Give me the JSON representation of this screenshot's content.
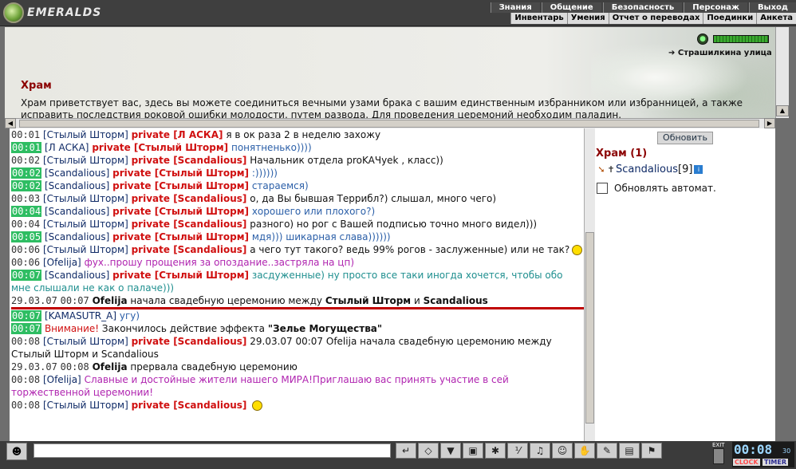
{
  "app": {
    "logo_text": "EMERALDS"
  },
  "menu": {
    "main": [
      "Знания",
      "Общение",
      "Безопасность",
      "Персонаж",
      "Выход"
    ],
    "sub": [
      "Инвентарь",
      "Умения",
      "Отчет о переводах",
      "Поединки",
      "Анкета"
    ]
  },
  "location": {
    "link": "Страшилкина улица",
    "title": "Храм",
    "description": "Храм приветствует вас, здесь вы можете соединиться вечными узами брака с вашим единственным избранником или избранницей, а также исправить последствия роковой ошибки молодости, путем развода. Для проведения церемоний необходим паладин."
  },
  "chat": {
    "lines": [
      {
        "ts": "00:01",
        "ts_style": "plain",
        "nick": "[Стылый Шторм]",
        "priv": "private [Л АСКА]",
        "msg": "я в ок раза 2 в неделю захожу",
        "msg_style": "black"
      },
      {
        "ts": "00:01",
        "ts_style": "green",
        "nick": "[Л АСКА]",
        "priv": "private [Стылый Шторм]",
        "msg": "понятненько))))",
        "msg_style": "blue"
      },
      {
        "ts": "00:02",
        "ts_style": "plain",
        "nick": "[Стылый Шторм]",
        "priv": "private [Scandalious]",
        "msg": "Начальник отдела proKAЧyek , класс))",
        "msg_style": "black"
      },
      {
        "ts": "00:02",
        "ts_style": "green",
        "nick": "[Scandalious]",
        "priv": "private [Стылый Шторм]",
        "msg": ":))))))",
        "msg_style": "blue"
      },
      {
        "ts": "00:02",
        "ts_style": "green",
        "nick": "[Scandalious]",
        "priv": "private [Стылый Шторм]",
        "msg": "стараемся)",
        "msg_style": "blue"
      },
      {
        "ts": "00:03",
        "ts_style": "plain",
        "nick": "[Стылый Шторм]",
        "priv": "private [Scandalious]",
        "msg": "о, да Вы бывшая Террибл?) слышал, много чего)",
        "msg_style": "black"
      },
      {
        "ts": "00:04",
        "ts_style": "green",
        "nick": "[Scandalious]",
        "priv": "private [Стылый Шторм]",
        "msg": "хорошего или плохого?)",
        "msg_style": "blue"
      },
      {
        "ts": "00:04",
        "ts_style": "plain",
        "nick": "[Стылый Шторм]",
        "priv": "private [Scandalious]",
        "msg": "разного) но рог с Вашей подписью точно много видел)))",
        "msg_style": "black"
      },
      {
        "ts": "00:05",
        "ts_style": "green",
        "nick": "[Scandalious]",
        "priv": "private [Стылый Шторм]",
        "msg": "мдя))) шикарная слава))))))",
        "msg_style": "blue"
      },
      {
        "ts": "00:06",
        "ts_style": "plain",
        "nick": "[Стылый Шторм]",
        "priv": "private [Scandalious]",
        "msg": "а чего тут такого? ведь 99% рогов - заслуженные) или не так?",
        "msg_style": "black",
        "smile": true
      },
      {
        "ts": "00:06",
        "ts_style": "plain",
        "nick": "[Ofelija]",
        "priv": "",
        "msg": "фух..прошу прощения за опоздание..застряла на цп)",
        "msg_style": "purple"
      },
      {
        "ts": "00:07",
        "ts_style": "green",
        "nick": "[Scandalious]",
        "priv": "private [Стылый Шторм]",
        "msg": "засдуженные) ну просто все таки иногда хочется, чтобы обо мне слышали не как о палаче)))",
        "msg_style": "teal"
      }
    ],
    "ceremony": {
      "date": "29.03.07",
      "time": "00:07",
      "who": "Ofelija",
      "text1": "начала свадебную церемонию между",
      "p1": "Стылый Шторм",
      "and": "и",
      "p2": "Scandalious"
    },
    "lines2": [
      {
        "ts": "00:07",
        "ts_style": "green",
        "nick": "[KAMASUTR_A]",
        "priv": "",
        "msg": "угу)",
        "msg_style": "blue"
      },
      {
        "ts": "00:07",
        "ts_style": "green",
        "warn": "Внимание!",
        "msg": "Закончилось действие эффекта",
        "effect": "\"Зелье Могущества\""
      },
      {
        "ts": "00:08",
        "ts_style": "plain",
        "nick": "[Стылый Шторм]",
        "priv": "private [Scandalious]",
        "msg": "29.03.07 00:07 Ofelija начала свадебную церемонию между Стылый Шторм и Scandalious",
        "msg_style": "black"
      }
    ],
    "interrupt": {
      "date": "29.03.07",
      "time": "00:08",
      "who": "Ofelija",
      "text": "прервала свадебную церемонию"
    },
    "lines3": [
      {
        "ts": "00:08",
        "ts_style": "plain",
        "nick": "[Ofelija]",
        "priv": "",
        "msg": "Славные и достойные жители нашего МИРА!Приглашаю вас принять участие в сей торжественной церемонии!",
        "msg_style": "purple"
      },
      {
        "ts": "00:08",
        "ts_style": "plain",
        "nick": "[Стылый Шторм]",
        "priv": "private [Scandalious]",
        "msg": "",
        "msg_style": "black",
        "smile": true
      }
    ]
  },
  "sidebar": {
    "refresh_label": "Обновить",
    "room_count": "Храм (1)",
    "user": {
      "name": "Scandalious",
      "level": "[9]"
    },
    "auto_label": "Обновлять автомат."
  },
  "bottom": {
    "exit_label": "EXIT",
    "clock_time": "00:08",
    "clock_seconds": "30",
    "clock_label": "CLOCK",
    "timer_label": "TIMER"
  }
}
